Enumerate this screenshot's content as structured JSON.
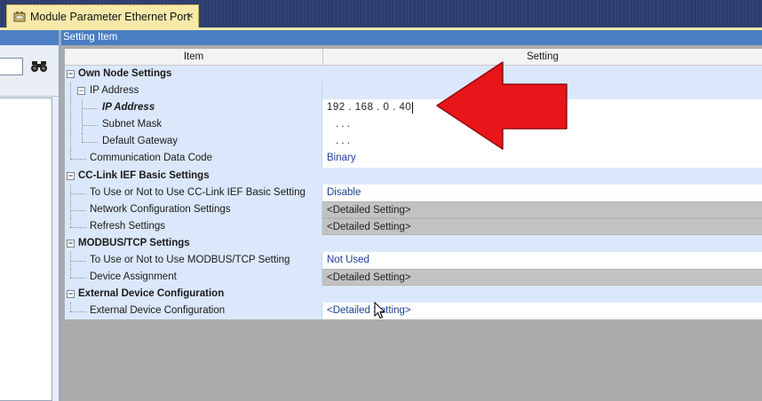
{
  "document_tab": {
    "title": "Module Parameter Ethernet Port",
    "close": "×",
    "icon": "module-parameter-icon"
  },
  "setting_item_header": "Setting Item",
  "columns": {
    "item": "Item",
    "setting": "Setting"
  },
  "rows": [
    {
      "type": "category",
      "toggle": "−",
      "label": "Own Node Settings"
    },
    {
      "type": "group",
      "toggle": "−",
      "label": "IP Address"
    },
    {
      "type": "param",
      "label": "IP Address",
      "value": "192 .  168 .   0   .   40",
      "selected": true
    },
    {
      "type": "param",
      "label": "Subnet Mask",
      "value": ".     .     ."
    },
    {
      "type": "param",
      "label": "Default Gateway",
      "value": ".     .     ."
    },
    {
      "type": "param",
      "label": "Communication Data Code",
      "value": "Binary"
    },
    {
      "type": "category",
      "toggle": "−",
      "label": "CC-Link IEF Basic Settings"
    },
    {
      "type": "param",
      "label": "To Use or Not to Use CC-Link IEF Basic Setting",
      "value": "Disable"
    },
    {
      "type": "param",
      "label": "Network Configuration Settings",
      "value": "<Detailed Setting>"
    },
    {
      "type": "param",
      "label": "Refresh Settings",
      "value": "<Detailed Setting>"
    },
    {
      "type": "category",
      "toggle": "−",
      "label": "MODBUS/TCP Settings"
    },
    {
      "type": "param",
      "label": "To Use or Not to Use MODBUS/TCP Setting",
      "value": "Not Used"
    },
    {
      "type": "param",
      "label": "Device Assignment",
      "value": "<Detailed Setting>"
    },
    {
      "type": "category",
      "toggle": "−",
      "label": "External Device Configuration"
    },
    {
      "type": "param",
      "label": "External Device Configuration",
      "value": "<Detailed Setting>"
    }
  ],
  "colors": {
    "accent": "#4a7ec3",
    "tab": "#f6e9a9",
    "row_bg": "#dbe8fb",
    "arrow": "#e8151b"
  }
}
